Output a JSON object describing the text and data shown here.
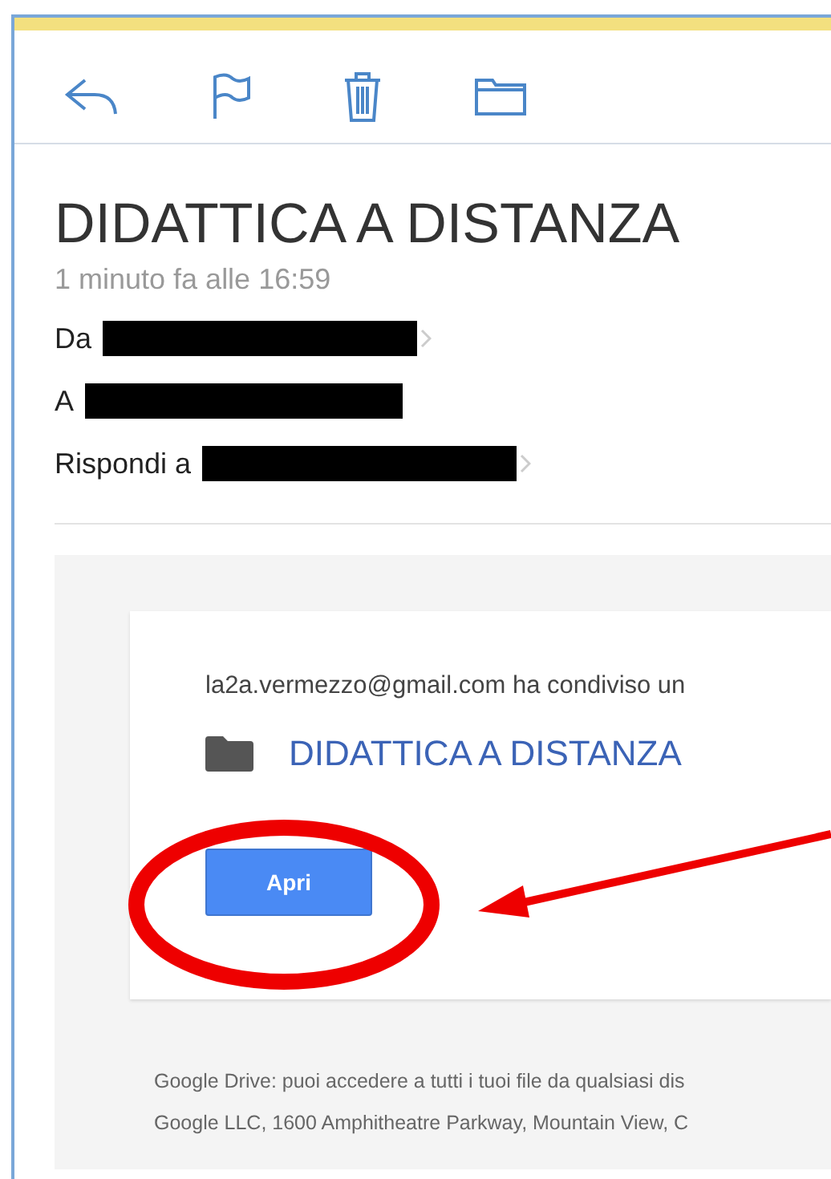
{
  "toolbar": {
    "buttons": [
      {
        "kind": "reply"
      },
      {
        "kind": "flag"
      },
      {
        "kind": "trash"
      },
      {
        "kind": "folder"
      }
    ]
  },
  "message": {
    "subject": "DIDATTICA A DISTANZA",
    "time": "1 minuto fa alle 16:59",
    "headers": [
      {
        "label": "Da",
        "chevron": true
      },
      {
        "label": "A",
        "chevron": false
      },
      {
        "label": "Rispondi a",
        "chevron": true
      }
    ]
  },
  "card": {
    "share_text": "la2a.vermezzo@gmail.com ha condiviso un",
    "folder_link": "DIDATTICA A DISTANZA",
    "button": "Apri"
  },
  "footer": [
    "Google Drive: puoi accedere a tutti i tuoi file da qualsiasi dis",
    "Google LLC, 1600 Amphitheatre Parkway, Mountain View, C"
  ]
}
